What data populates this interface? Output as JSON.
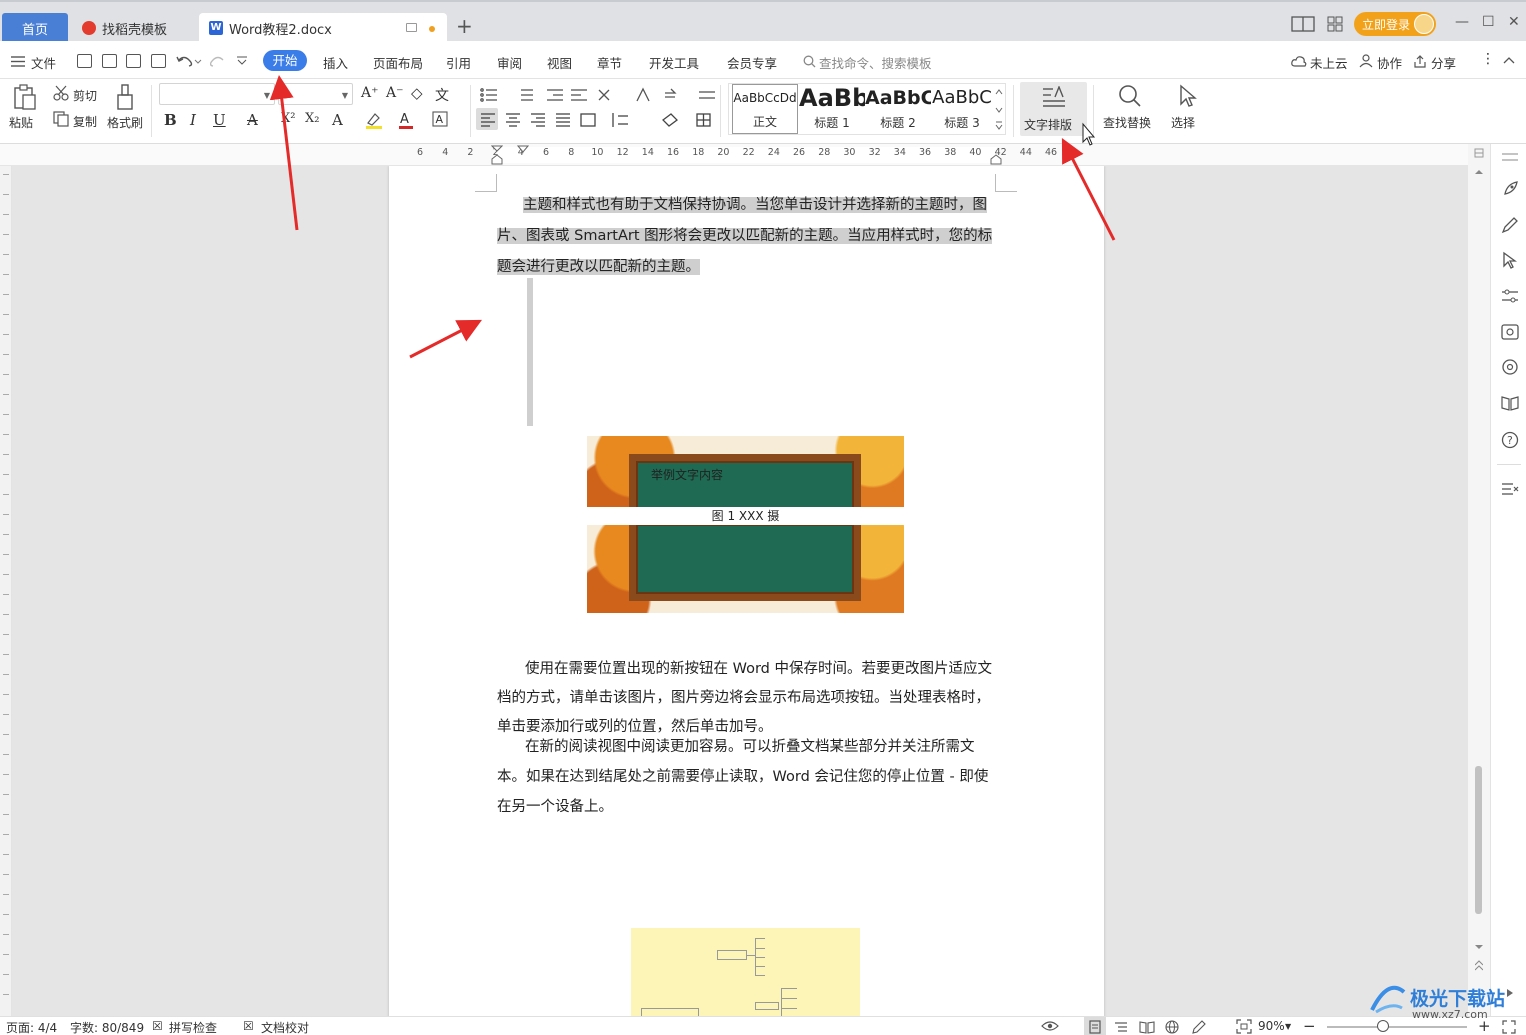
{
  "tabs": {
    "home": "首页",
    "template": "找稻壳模板",
    "document": "Word教程2.docx",
    "add": "+"
  },
  "titlebar": {
    "login": "立即登录",
    "minimize": "—",
    "maximize": "☐",
    "close": "✕"
  },
  "menu": {
    "file": "文件",
    "items": [
      "开始",
      "插入",
      "页面布局",
      "引用",
      "审阅",
      "视图",
      "章节",
      "开发工具",
      "会员专享"
    ],
    "search_placeholder": "查找命令、搜索模板",
    "cloud": "未上云",
    "collab": "协作",
    "share": "分享"
  },
  "ribbon": {
    "paste": "粘贴",
    "cut": "剪切",
    "copy": "复制",
    "format_painter": "格式刷",
    "styles": [
      {
        "preview": "AaBbCcDd",
        "name": "正文"
      },
      {
        "preview": "AaBb",
        "name": "标题 1"
      },
      {
        "preview": "AaBbC",
        "name": "标题 2"
      },
      {
        "preview": "AaBbC",
        "name": "标题 3"
      }
    ],
    "text_layout": "文字排版",
    "find_replace": "查找替换",
    "select": "选择"
  },
  "ruler": {
    "marks": [
      "6",
      "4",
      "2",
      "2",
      "4",
      "6",
      "8",
      "10",
      "12",
      "14",
      "16",
      "18",
      "20",
      "22",
      "24",
      "26",
      "28",
      "30",
      "32",
      "34",
      "36",
      "38",
      "40",
      "42",
      "44",
      "46"
    ]
  },
  "document": {
    "para1": "主题和样式也有助于文档保持协调。当您单击设计并选择新的主题时，图片、图表或 SmartArt 图形将会更改以匹配新的主题。当应用样式时，您的标题会进行更改以匹配新的主题。",
    "image_text": "举例文字内容",
    "caption": "图 1   XXX 摄",
    "para2": "使用在需要位置出现的新按钮在 Word 中保存时间。若要更改图片适应文档的方式，请单击该图片，图片旁边将会显示布局选项按钮。当处理表格时，单击要添加行或列的位置，然后单击加号。",
    "para3": "在新的阅读视图中阅读更加容易。可以折叠文档某些部分并关注所需文本。如果在达到结尾处之前需要停止读取，Word 会记住您的停止位置 - 即使在另一个设备上。"
  },
  "statusbar": {
    "page": "页面: 4/4",
    "words": "字数: 80/849",
    "spell": "拼写检查",
    "proof": "文档校对",
    "zoom": "90%",
    "zoom_level": 0.4
  },
  "watermark": {
    "name": "极光下载站",
    "url": "www.xz7.com"
  }
}
